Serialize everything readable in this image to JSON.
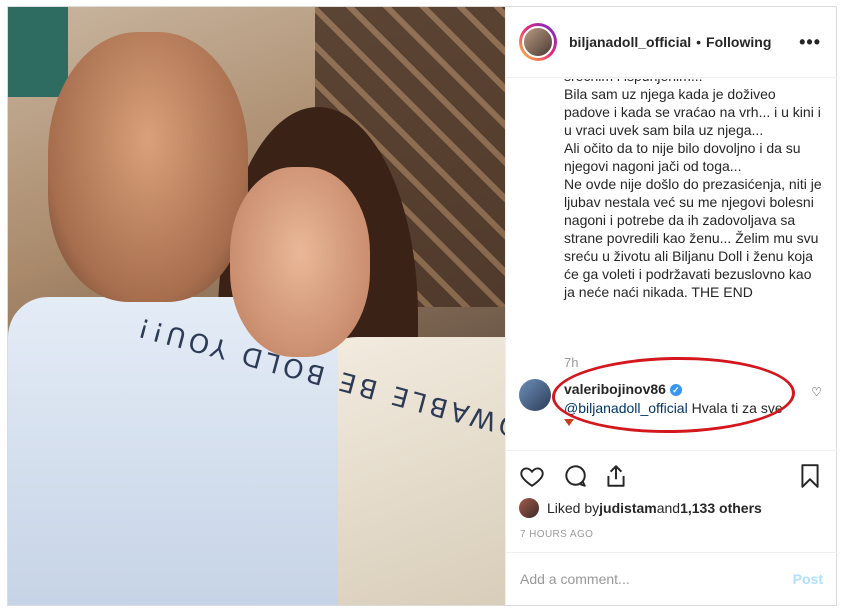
{
  "header": {
    "username": "biljanadoll_official",
    "separator": "•",
    "follow_status": "Following",
    "more": "•••"
  },
  "photo": {
    "shirt_text": "SHOWABLE BE BOLD YOU!!"
  },
  "caption": {
    "text": "srećnim i ispunjenim...\nBila sam uz njega kada je doživeo padove i kada se vraćao na vrh... i u kini i u vraci uvek sam bila uz njega...\nAli očito da to nije bilo dovoljno i da su njegovi nagoni jači od toga...\nNe ovde nije došlo do prezasićenja, niti je ljubav nestala već su me njegovi bolesni nagoni i potrebe da ih zadovoljava sa strane povredili kao ženu... Želim mu svu sreću u životu ali Biljanu Doll i ženu koja će ga voleti i podržavati bezuslovno kao ja neće naći nikada. THE END",
    "time": "7h"
  },
  "comment": {
    "username": "valeribojinov86",
    "verified": "✓",
    "mention": "@biljanadoll_official",
    "text": " Hvala ti za sve",
    "like_icon": "♡"
  },
  "likes": {
    "prefix": "Liked by ",
    "user": "judistam",
    "middle": " and ",
    "count": "1,133 others"
  },
  "timestamp": "7 HOURS AGO",
  "add_comment": {
    "placeholder": "Add a comment...",
    "post_label": "Post"
  },
  "colors": {
    "highlight_ellipse": "#d4161d",
    "verified": "#3897f0",
    "post_disabled": "#b2dffc"
  }
}
